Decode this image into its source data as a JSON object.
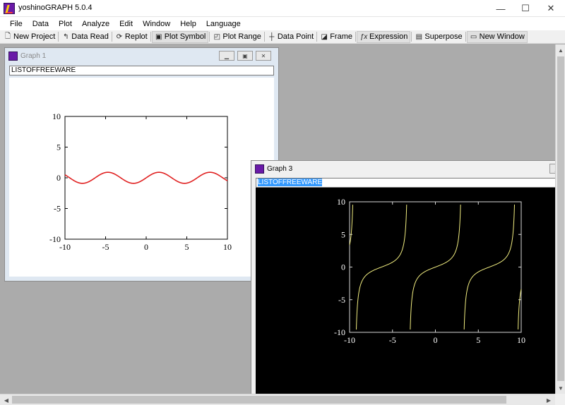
{
  "window": {
    "title": "yoshinoGRAPH 5.0.4",
    "minimize": "—",
    "maximize": "☐",
    "close": "✕"
  },
  "menu": [
    "File",
    "Data",
    "Plot",
    "Analyze",
    "Edit",
    "Window",
    "Help",
    "Language"
  ],
  "toolbar": [
    {
      "label": "New Project",
      "icon": "new-project-icon",
      "glyph": "🗋"
    },
    {
      "label": "Data Read",
      "icon": "data-read-icon",
      "glyph": "↰"
    },
    {
      "label": "Replot",
      "icon": "replot-icon",
      "glyph": "⟳"
    },
    {
      "label": "Plot Symbol",
      "icon": "plot-symbol-icon",
      "glyph": "▣",
      "pressed": true
    },
    {
      "label": "Plot Range",
      "icon": "plot-range-icon",
      "glyph": "◰"
    },
    {
      "label": "Data Point",
      "icon": "data-point-icon",
      "glyph": "┼"
    },
    {
      "label": "Frame",
      "icon": "frame-icon",
      "glyph": "◪"
    },
    {
      "label": "Expression",
      "icon": "expression-icon",
      "glyph": "ƒx"
    },
    {
      "label": "Superpose",
      "icon": "superpose-icon",
      "glyph": "▤"
    },
    {
      "label": "New Window",
      "icon": "new-window-icon",
      "glyph": "▭"
    }
  ],
  "graph1": {
    "title": "Graph 1",
    "comment": "LISTOFFREEWARE",
    "background": "#ffffff",
    "axis_color": "#000000",
    "curve_color": "#e02020"
  },
  "graph3": {
    "title": "Graph 3",
    "comment": "LISTOFFREEWARE",
    "background": "#000000",
    "axis_color": "#d8d8d8",
    "curve_color": "#f2ee80",
    "comment_highlight": "#3399ff"
  },
  "chart_data": [
    {
      "type": "line",
      "series": [
        {
          "expression": "0.9*sin(x)",
          "x_range": [
            -10,
            10
          ]
        }
      ],
      "xlim": [
        -10,
        10
      ],
      "ylim": [
        -10,
        10
      ],
      "xticks": [
        "-10",
        "-5",
        "0",
        "5",
        "10"
      ],
      "yticks": [
        "10",
        "5",
        "0",
        "-5",
        "-10"
      ],
      "grid": false
    },
    {
      "type": "line",
      "series": [
        {
          "expression": "tan(x/2)",
          "x_range": [
            -10,
            10
          ]
        }
      ],
      "xlim": [
        -10,
        10
      ],
      "ylim": [
        -10,
        10
      ],
      "xticks": [
        "-10",
        "-5",
        "0",
        "5",
        "10"
      ],
      "yticks": [
        "10",
        "5",
        "0",
        "-5",
        "-10"
      ],
      "grid": false
    }
  ]
}
